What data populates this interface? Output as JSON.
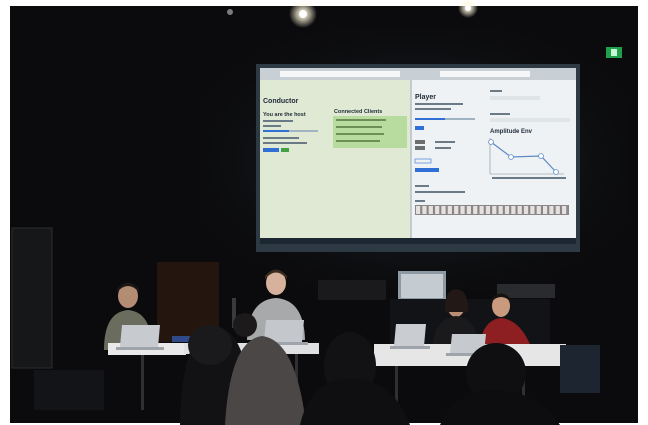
{
  "left_panel": {
    "title": "Conductor",
    "subtitle": "You are the host",
    "clients_heading": "Connected Clients"
  },
  "right_panel": {
    "title": "Player",
    "graph_heading": "Amplitude Env"
  },
  "colors": {
    "wall": "#0b0b0d",
    "screen_bg": "#e9eef0",
    "left_panel_bg": "#cfe6b8",
    "client_box": "#b8dca0",
    "accent_blue": "#2f6fd6",
    "accent_green": "#43a047",
    "exit_sign": "#21a04b",
    "table": "#e9e9ea"
  },
  "icons": [
    "exit-sign-icon",
    "laptop-icon",
    "ceiling-light-icon"
  ]
}
